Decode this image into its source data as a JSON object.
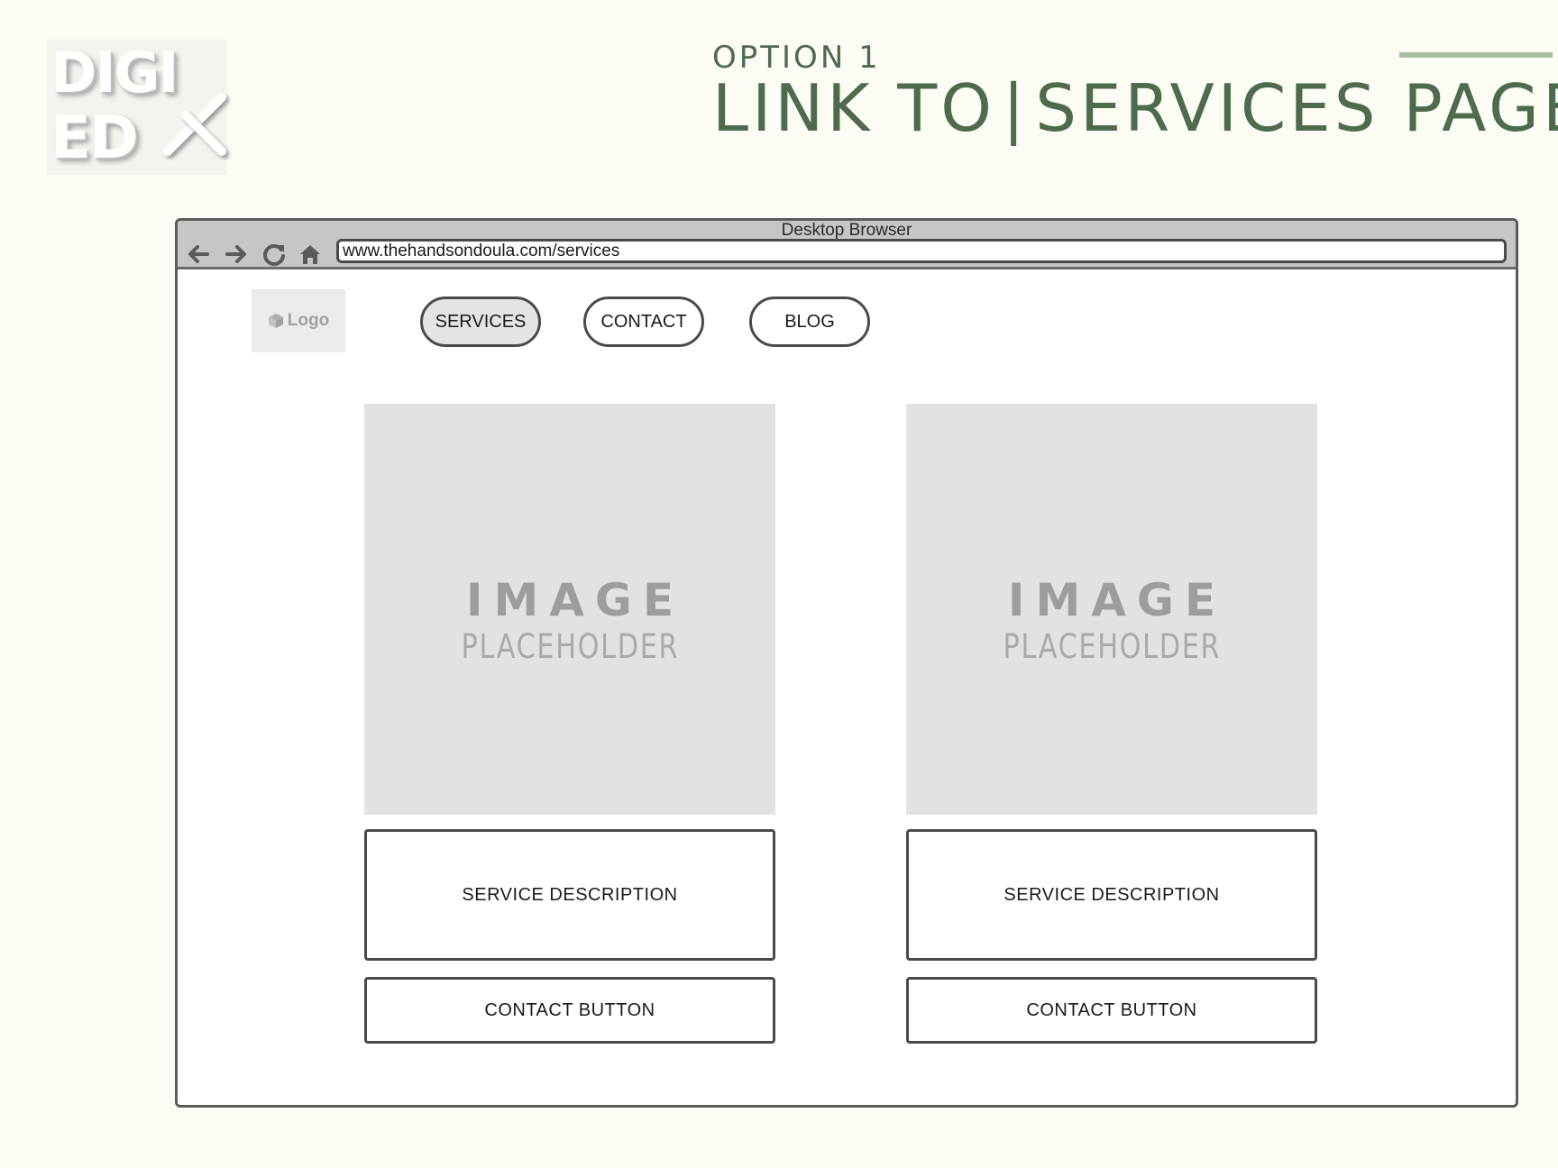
{
  "brand": {
    "line1": "DIGI",
    "line2": "ED"
  },
  "heading": {
    "subtitle": "OPTION 1",
    "left": "LINK TO",
    "separator": "|",
    "right": "SERVICES PAGE"
  },
  "browser": {
    "title": "Desktop Browser",
    "url": "www.thehandsondoula.com/services",
    "nav_icons": [
      "back-arrow-icon",
      "forward-arrow-icon",
      "refresh-icon",
      "home-icon"
    ]
  },
  "site": {
    "logo_label": "Logo",
    "nav": [
      {
        "label": "SERVICES",
        "active": true
      },
      {
        "label": "CONTACT",
        "active": false
      },
      {
        "label": "BLOG",
        "active": false
      }
    ],
    "cards": [
      {
        "image_line1": "IMAGE",
        "image_line2": "PLACEHOLDER",
        "description": "SERVICE DESCRIPTION",
        "button": "CONTACT BUTTON"
      },
      {
        "image_line1": "IMAGE",
        "image_line2": "PLACEHOLDER",
        "description": "SERVICE DESCRIPTION",
        "button": "CONTACT BUTTON"
      }
    ]
  },
  "colors": {
    "background": "#fcfcf5",
    "heading": "#4e6b4e",
    "heading_rule": "#a8c0a0",
    "chrome": "#c6c6c6",
    "placeholder": "#e2e2e2"
  }
}
